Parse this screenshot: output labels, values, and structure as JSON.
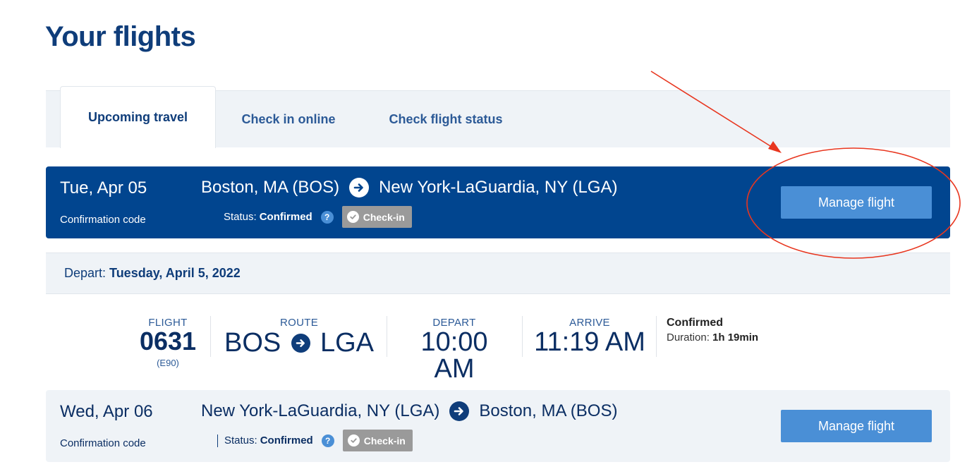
{
  "page": {
    "title": "Your flights"
  },
  "tabs": [
    {
      "label": "Upcoming travel",
      "active": true
    },
    {
      "label": "Check in online",
      "active": false
    },
    {
      "label": "Check flight status",
      "active": false
    }
  ],
  "trips": [
    {
      "date": "Tue, Apr 05",
      "origin": "Boston, MA (BOS)",
      "destination": "New York-LaGuardia, NY (LGA)",
      "confirmation_label": "Confirmation code",
      "status_label": "Status:",
      "status_value": "Confirmed",
      "help_glyph": "?",
      "checkin_label": "Check-in",
      "manage_label": "Manage flight"
    },
    {
      "date": "Wed, Apr 06",
      "origin": "New York-LaGuardia, NY (LGA)",
      "destination": "Boston, MA (BOS)",
      "confirmation_label": "Confirmation code",
      "status_label": "Status:",
      "status_value": "Confirmed",
      "help_glyph": "?",
      "checkin_label": "Check-in",
      "manage_label": "Manage flight"
    }
  ],
  "depart_section": {
    "label": "Depart:",
    "date": "Tuesday, April 5, 2022"
  },
  "segment": {
    "flight_label": "FLIGHT",
    "flight_number": "0631",
    "aircraft": "(E90)",
    "route_label": "ROUTE",
    "from": "BOS",
    "to": "LGA",
    "depart_label": "DEPART",
    "depart_time": "10:00 AM",
    "arrive_label": "ARRIVE",
    "arrive_time": "11:19 AM",
    "status": "Confirmed",
    "duration_label": "Duration:",
    "duration": "1h 19min"
  },
  "icons": {
    "route_arrow": "arrow-right-circle-icon",
    "help": "question-circle-icon",
    "checkin": "check-circle-icon"
  },
  "colors": {
    "brand_dark": "#01458f",
    "button_blue": "#4a8fd6",
    "panel_bg": "#eff3f7",
    "annotation_red": "#e8361f"
  }
}
